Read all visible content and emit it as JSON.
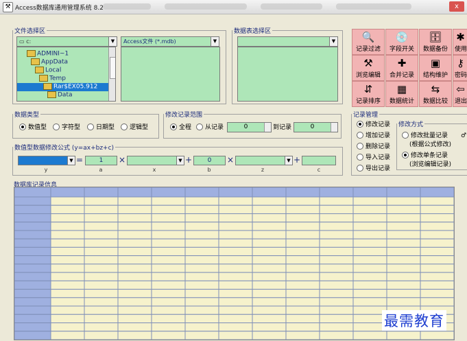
{
  "window": {
    "title": "Access数据库通用管理系统 8.2",
    "close_glyph": "x"
  },
  "file_select": {
    "legend": "文件选择区",
    "drive": "c:",
    "filter": "Access文件 (*.mdb)",
    "tree": [
      "ADMINI~1",
      "AppData",
      "Local",
      "Temp",
      "Rar$EX05.912",
      "Data"
    ]
  },
  "table_select": {
    "legend": "数据表选择区"
  },
  "toolbar": {
    "rows": [
      [
        {
          "label": "记录过滤",
          "icon": "magnifier-icon",
          "glyph": "🔍"
        },
        {
          "label": "字段开关",
          "icon": "disc-icon",
          "glyph": "💿"
        },
        {
          "label": "数据备份",
          "icon": "database-icon",
          "glyph": "🗄"
        },
        {
          "label": "使用",
          "icon": "help-icon",
          "glyph": "✱"
        }
      ],
      [
        {
          "label": "浏览编辑",
          "icon": "tools-icon",
          "glyph": "⚒"
        },
        {
          "label": "合并记录",
          "icon": "merge-icon",
          "glyph": "✚"
        },
        {
          "label": "结构维护",
          "icon": "structure-icon",
          "glyph": "▣"
        },
        {
          "label": "密码",
          "icon": "key-icon",
          "glyph": "⚷"
        }
      ],
      [
        {
          "label": "记录排序",
          "icon": "sort-icon",
          "glyph": "⇵"
        },
        {
          "label": "数据统计",
          "icon": "calculator-icon",
          "glyph": "▦"
        },
        {
          "label": "数据比较",
          "icon": "compare-icon",
          "glyph": "⇆"
        },
        {
          "label": "退出",
          "icon": "exit-icon",
          "glyph": "⇦"
        }
      ]
    ]
  },
  "data_type": {
    "legend": "数据类型",
    "options": [
      "数值型",
      "字符型",
      "日期型",
      "逻辑型"
    ],
    "selected": 0
  },
  "modify_range": {
    "legend": "修改记录范围",
    "all": "全程",
    "from": "从记录",
    "from_value": "0",
    "to": "到记录",
    "to_value": "0"
  },
  "record_mgmt": {
    "legend": "记录管理",
    "options": [
      "修改记录",
      "增加记录",
      "删除记录",
      "导入记录",
      "导出记录"
    ],
    "selected": 0
  },
  "modify_mode": {
    "legend": "修改方式",
    "batch": "修改批量记录",
    "batch_note": "(根据公式修改)",
    "single": "修改单条记录",
    "single_note": "(浏览编辑记录)",
    "extra_glyph": "♂"
  },
  "formula": {
    "legend": "数值型数据修改公式 (y=ax+bz+c)",
    "eq": "=",
    "times": "×",
    "plus": "+",
    "a": "1",
    "b": "0",
    "labels": {
      "y": "y",
      "a": "a",
      "x": "x",
      "b": "b",
      "z": "z",
      "c": "c"
    }
  },
  "record_info": {
    "legend": "数据库记录信息",
    "columns": 12,
    "rows": 17
  },
  "watermark": "最需教育"
}
